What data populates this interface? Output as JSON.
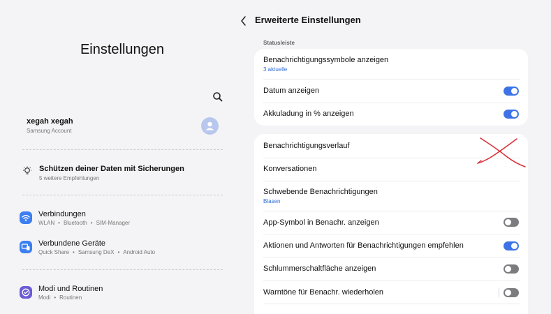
{
  "left": {
    "title": "Einstellungen",
    "account": {
      "name": "xegah xegah",
      "subtitle": "Samsung Account"
    },
    "backup": {
      "title": "Schützen deiner Daten mit Sicherungen",
      "subtitle": "5 weitere Empfehlungen"
    },
    "menu": [
      {
        "title": "Verbindungen",
        "sub": [
          "WLAN",
          "Bluetooth",
          "SIM-Manager"
        ],
        "icon": "wifi-icon",
        "color": "#3d7ff0"
      },
      {
        "title": "Verbundene Geräte",
        "sub": [
          "Quick Share",
          "Samsung DeX",
          "Android Auto"
        ],
        "icon": "devices-icon",
        "color": "#3d7ff0"
      },
      {
        "title": "Modi und Routinen",
        "sub": [
          "Modi",
          "Routinen"
        ],
        "icon": "modes-icon",
        "color": "#6b5bd6"
      }
    ]
  },
  "right": {
    "title": "Erweiterte Einstellungen",
    "section_label": "Statusleiste",
    "card1": {
      "rows": [
        {
          "title": "Benachrichtigungssymbole anzeigen",
          "sub": "3 aktuelle"
        },
        {
          "title": "Datum anzeigen",
          "toggle": true
        },
        {
          "title": "Akkuladung in % anzeigen",
          "toggle": true
        }
      ]
    },
    "card2": {
      "rows": [
        {
          "title": "Benachrichtigungsverlauf"
        },
        {
          "title": "Konversationen"
        },
        {
          "title": "Schwebende Benachrichtigungen",
          "sub": "Blasen"
        },
        {
          "title": "App-Symbol in Benachr. anzeigen",
          "toggle": false
        },
        {
          "title": "Aktionen und Antworten für Benachrichtigungen empfehlen",
          "toggle": true
        },
        {
          "title": "Schlummerschaltfläche anzeigen",
          "toggle": false
        },
        {
          "title": "Warntöne für Benachr. wiederholen",
          "toggle": false
        }
      ]
    }
  },
  "colors": {
    "accent": "#3d73e6",
    "toggle_off": "#7c7c80",
    "annotation": "#d8313a",
    "background": "#f4f4f6"
  }
}
